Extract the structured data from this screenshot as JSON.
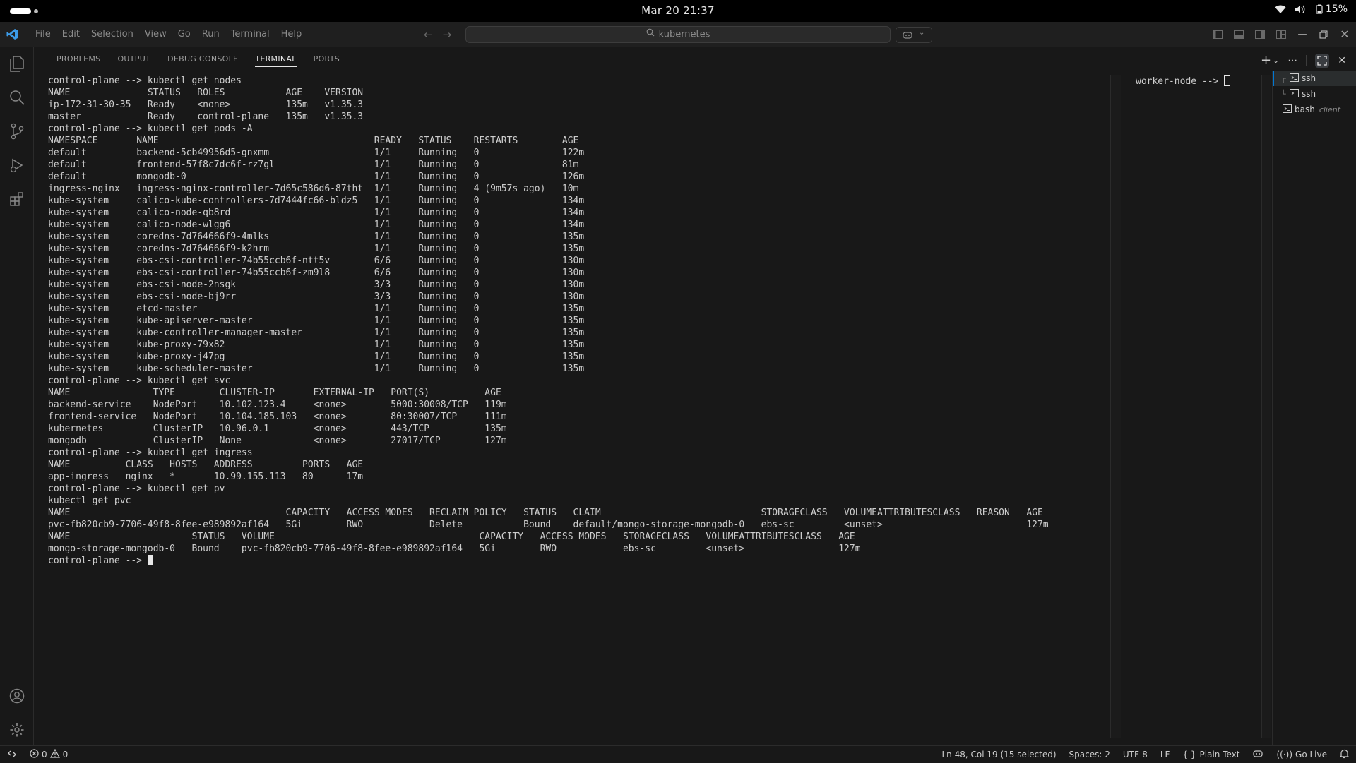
{
  "system_bar": {
    "clock": "Mar 20  21:37",
    "battery": "15%"
  },
  "titlebar": {
    "menu": [
      "File",
      "Edit",
      "Selection",
      "View",
      "Go",
      "Run",
      "Terminal",
      "Help"
    ],
    "search_text": "kubernetes"
  },
  "panel": {
    "tabs": [
      "PROBLEMS",
      "OUTPUT",
      "DEBUG CONSOLE",
      "TERMINAL",
      "PORTS"
    ],
    "active_tab": "TERMINAL"
  },
  "terminal": {
    "main_lines": [
      "control-plane --> kubectl get nodes",
      "NAME              STATUS   ROLES           AGE    VERSION",
      "ip-172-31-30-35   Ready    <none>          135m   v1.35.3",
      "master            Ready    control-plane   135m   v1.35.3",
      "control-plane --> kubectl get pods -A",
      "NAMESPACE       NAME                                       READY   STATUS    RESTARTS        AGE",
      "default         backend-5cb49956d5-gnxmm                   1/1     Running   0               122m",
      "default         frontend-57f8c7dc6f-rz7gl                  1/1     Running   0               81m",
      "default         mongodb-0                                  1/1     Running   0               126m",
      "ingress-nginx   ingress-nginx-controller-7d65c586d6-87tht  1/1     Running   4 (9m57s ago)   10m",
      "kube-system     calico-kube-controllers-7d7444fc66-bldz5   1/1     Running   0               134m",
      "kube-system     calico-node-qb8rd                          1/1     Running   0               134m",
      "kube-system     calico-node-wlgg6                          1/1     Running   0               134m",
      "kube-system     coredns-7d764666f9-4mlks                   1/1     Running   0               135m",
      "kube-system     coredns-7d764666f9-k2hrm                   1/1     Running   0               135m",
      "kube-system     ebs-csi-controller-74b55ccb6f-ntt5v        6/6     Running   0               130m",
      "kube-system     ebs-csi-controller-74b55ccb6f-zm9l8        6/6     Running   0               130m",
      "kube-system     ebs-csi-node-2nsgk                         3/3     Running   0               130m",
      "kube-system     ebs-csi-node-bj9rr                         3/3     Running   0               130m",
      "kube-system     etcd-master                                1/1     Running   0               135m",
      "kube-system     kube-apiserver-master                      1/1     Running   0               135m",
      "kube-system     kube-controller-manager-master             1/1     Running   0               135m",
      "kube-system     kube-proxy-79x82                           1/1     Running   0               135m",
      "kube-system     kube-proxy-j47pg                           1/1     Running   0               135m",
      "kube-system     kube-scheduler-master                      1/1     Running   0               135m",
      "control-plane --> kubectl get svc",
      "NAME               TYPE        CLUSTER-IP       EXTERNAL-IP   PORT(S)          AGE",
      "backend-service    NodePort    10.102.123.4     <none>        5000:30008/TCP   119m",
      "frontend-service   NodePort    10.104.185.103   <none>        80:30007/TCP     111m",
      "kubernetes         ClusterIP   10.96.0.1        <none>        443/TCP          135m",
      "mongodb            ClusterIP   None             <none>        27017/TCP        127m",
      "control-plane --> kubectl get ingress",
      "NAME          CLASS   HOSTS   ADDRESS         PORTS   AGE",
      "app-ingress   nginx   *       10.99.155.113   80      17m",
      "control-plane --> kubectl get pv",
      "kubectl get pvc",
      "NAME                                       CAPACITY   ACCESS MODES   RECLAIM POLICY   STATUS   CLAIM                             STORAGECLASS   VOLUMEATTRIBUTESCLASS   REASON   AGE",
      "pvc-fb820cb9-7706-49f8-8fee-e989892af164   5Gi        RWO            Delete           Bound    default/mongo-storage-mongodb-0   ebs-sc         <unset>                          127m",
      "NAME                      STATUS   VOLUME                                     CAPACITY   ACCESS MODES   STORAGECLASS   VOLUMEATTRIBUTESCLASS   AGE",
      "mongo-storage-mongodb-0   Bound    pvc-fb820cb9-7706-49f8-8fee-e989892af164   5Gi        RWO            ebs-sc         <unset>                 127m"
    ],
    "main_prompt": "control-plane --> ",
    "side_prompt": "worker-node --> ",
    "sessions": [
      {
        "tree": "┌",
        "label": "ssh",
        "desc": ""
      },
      {
        "tree": "└",
        "label": "ssh",
        "desc": ""
      },
      {
        "tree": "",
        "label": "bash",
        "desc": "client"
      }
    ]
  },
  "statusbar": {
    "errors": "0",
    "warnings": "0",
    "position": "Ln 48, Col 19 (15 selected)",
    "spaces": "Spaces: 2",
    "encoding": "UTF-8",
    "eol": "LF",
    "language": "Plain Text",
    "go_live": "Go Live"
  }
}
